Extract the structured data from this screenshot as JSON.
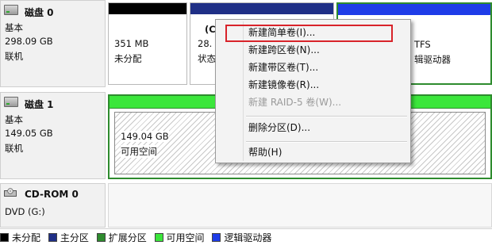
{
  "disks": [
    {
      "name": "磁盘 0",
      "type": "基本",
      "size": "298.09 GB",
      "status": "联机"
    },
    {
      "name": "磁盘 1",
      "type": "基本",
      "size": "149.05 GB",
      "status": "联机"
    },
    {
      "name": "CD-ROM 0",
      "type": "DVD (G:)"
    }
  ],
  "disk0_partitions": {
    "p1": {
      "size": "351 MB",
      "status": "未分配"
    },
    "p2": {
      "size": "28.",
      "status": "状态"
    },
    "p2_tag": "(C",
    "p3": {
      "size": "TFS",
      "status": "辑驱动器"
    }
  },
  "disk1_partitions": {
    "p1": {
      "size": "149.04 GB",
      "status": "可用空间"
    }
  },
  "context_menu": [
    {
      "label": "新建简单卷(I)...",
      "enabled": true
    },
    {
      "label": "新建跨区卷(N)...",
      "enabled": true
    },
    {
      "label": "新建带区卷(T)...",
      "enabled": true
    },
    {
      "label": "新建镜像卷(R)...",
      "enabled": true
    },
    {
      "label": "新建 RAID-5 卷(W)...",
      "enabled": false
    },
    {
      "label": "删除分区(D)...",
      "enabled": true
    },
    {
      "label": "帮助(H)",
      "enabled": true
    }
  ],
  "legend": [
    {
      "label": "未分配",
      "color": "#000000"
    },
    {
      "label": "主分区",
      "color": "#1f2f86"
    },
    {
      "label": "扩展分区",
      "color": "#2e8b2e"
    },
    {
      "label": "可用空间",
      "color": "#3be63b"
    },
    {
      "label": "逻辑驱动器",
      "color": "#1e3ce8"
    }
  ],
  "colors": {
    "unallocated": "#000000",
    "primary": "#1f2f86",
    "extended": "#2e8b2e",
    "free": "#3be63b",
    "logical": "#1e3ce8",
    "menu_highlight": "#d8232a"
  }
}
